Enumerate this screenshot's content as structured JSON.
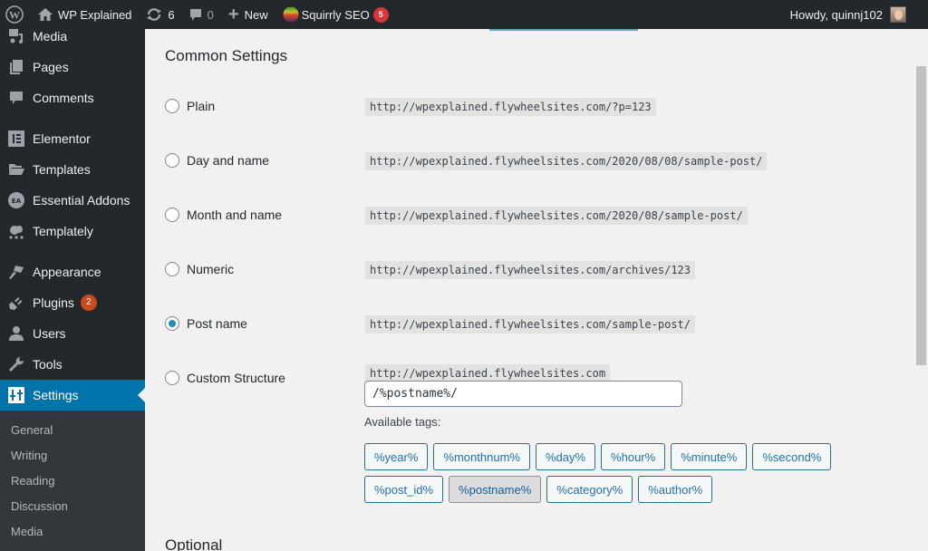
{
  "adminbar": {
    "wp_logo": "wordpress-icon",
    "site_name": "WP Explained",
    "updates_count": "6",
    "comments_count": "0",
    "new_label": "New",
    "seo_label": "Squirrly SEO",
    "seo_badge": "5",
    "greeting": "Howdy, quinnj102"
  },
  "sidebar": {
    "items": [
      {
        "label": "Media",
        "icon": "media-icon"
      },
      {
        "label": "Pages",
        "icon": "pages-icon"
      },
      {
        "label": "Comments",
        "icon": "comments-icon"
      },
      {
        "label": "Elementor",
        "icon": "elementor-icon"
      },
      {
        "label": "Templates",
        "icon": "folder-icon"
      },
      {
        "label": "Essential Addons",
        "icon": "essential-addons-icon"
      },
      {
        "label": "Templately",
        "icon": "templately-icon"
      },
      {
        "label": "Appearance",
        "icon": "paintbrush-icon"
      },
      {
        "label": "Plugins",
        "icon": "plugin-icon",
        "badge": "2"
      },
      {
        "label": "Users",
        "icon": "user-icon"
      },
      {
        "label": "Tools",
        "icon": "wrench-icon"
      },
      {
        "label": "Settings",
        "icon": "settings-icon",
        "active": true
      }
    ],
    "submenu": [
      "General",
      "Writing",
      "Reading",
      "Discussion",
      "Media"
    ]
  },
  "main": {
    "section_title": "Common Settings",
    "options": [
      {
        "label": "Plain",
        "example": "http://wpexplained.flywheelsites.com/?p=123",
        "checked": false
      },
      {
        "label": "Day and name",
        "example": "http://wpexplained.flywheelsites.com/2020/08/08/sample-post/",
        "checked": false
      },
      {
        "label": "Month and name",
        "example": "http://wpexplained.flywheelsites.com/2020/08/sample-post/",
        "checked": false
      },
      {
        "label": "Numeric",
        "example": "http://wpexplained.flywheelsites.com/archives/123",
        "checked": false
      },
      {
        "label": "Post name",
        "example": "http://wpexplained.flywheelsites.com/sample-post/",
        "checked": true
      },
      {
        "label": "Custom Structure",
        "example": "http://wpexplained.flywheelsites.com",
        "checked": false
      }
    ],
    "custom_structure_value": "/%postname%/",
    "available_tags_label": "Available tags:",
    "tags": [
      "%year%",
      "%monthnum%",
      "%day%",
      "%hour%",
      "%minute%",
      "%second%",
      "%post_id%",
      "%postname%",
      "%category%",
      "%author%"
    ],
    "pressed_tag": "%postname%",
    "next_section_title": "Optional"
  },
  "colors": {
    "adminbar_bg": "#23282d",
    "accent": "#0073aa",
    "radio_checked": "#1e8cbe",
    "badge_red": "#d63638",
    "badge_orange": "#ca4a1f"
  }
}
